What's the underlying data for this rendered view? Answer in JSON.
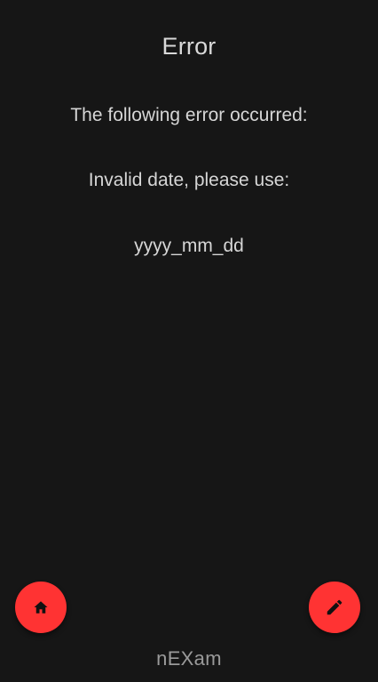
{
  "header": {
    "title": "Error"
  },
  "content": {
    "intro": "The following error occurred:",
    "message": "Invalid date, please use:",
    "format": "yyyy_mm_dd"
  },
  "actions": {
    "home_icon": "home-icon",
    "edit_icon": "pencil-icon",
    "accent_color": "#ff3333"
  },
  "footer": {
    "app_name": "nEXam"
  },
  "colors": {
    "background": "#161616",
    "text": "#d6d6d6",
    "footer_text": "#9a9a9a"
  }
}
